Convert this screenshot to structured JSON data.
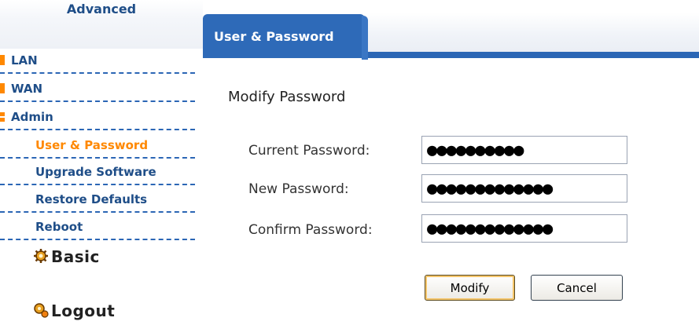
{
  "sidebar": {
    "title": "Advanced",
    "items": [
      {
        "label": "LAN"
      },
      {
        "label": "WAN"
      },
      {
        "label": "Admin"
      }
    ],
    "subitems": [
      {
        "label": "User & Password"
      },
      {
        "label": "Upgrade Software"
      },
      {
        "label": "Restore Defaults"
      },
      {
        "label": "Reboot"
      }
    ],
    "basic_label": "Basic",
    "logout_label": "Logout"
  },
  "main": {
    "tab_label": "User & Password",
    "section_title": "Modify Password",
    "fields": [
      {
        "label": "Current Password:",
        "value": "●●●●●●●●●●"
      },
      {
        "label": "New Password:",
        "value": "●●●●●●●●●●●●●"
      },
      {
        "label": "Confirm Password:",
        "value": "●●●●●●●●●●●●●"
      }
    ],
    "modify_label": "Modify",
    "cancel_label": "Cancel"
  },
  "colors": {
    "accent": "#2e6ab8",
    "nav_text": "#1f4e88",
    "active": "#ff8800"
  }
}
